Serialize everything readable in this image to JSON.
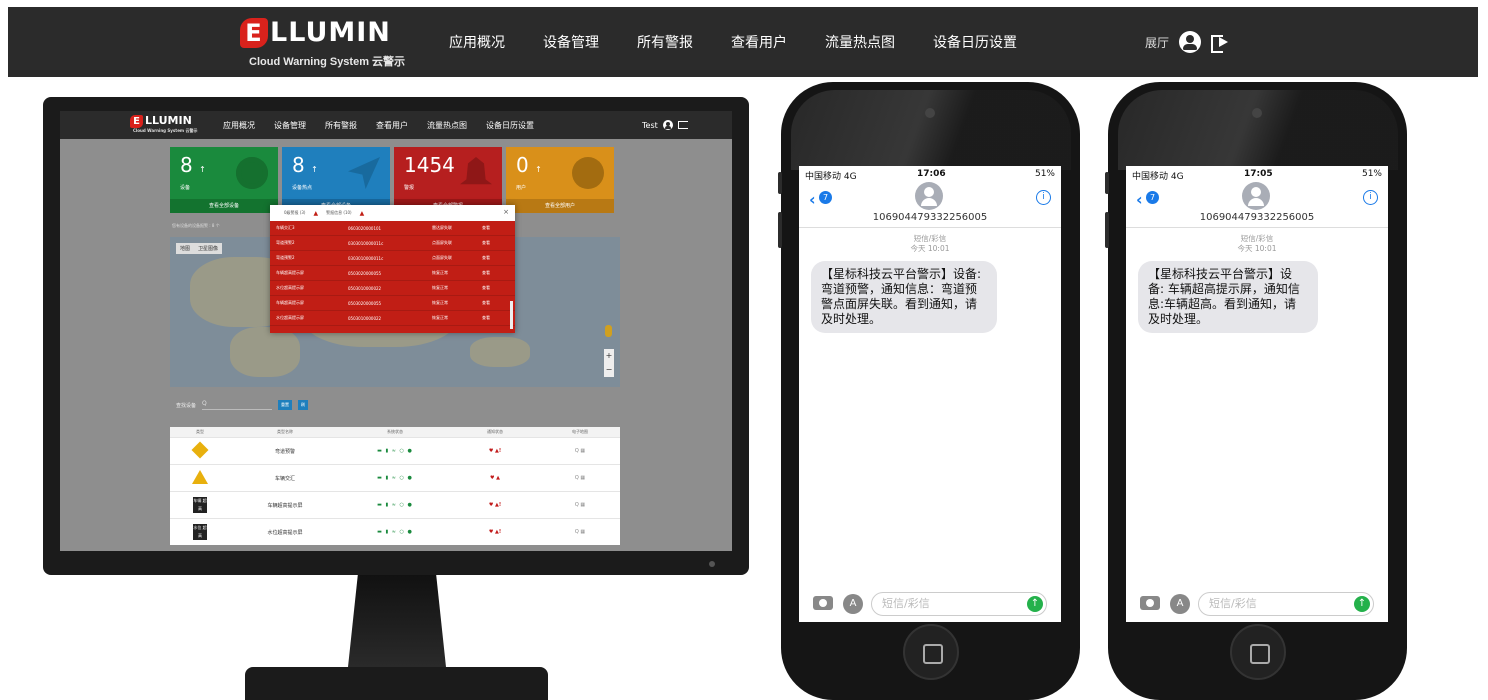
{
  "app": {
    "brand_name": "LLUMIN",
    "brand_initial": "E",
    "brand_subtitle": "Cloud  Warning System  云警示",
    "nav": [
      "应用概况",
      "设备管理",
      "所有警报",
      "查看用户",
      "流量热点图",
      "设备日历设置"
    ],
    "user_label": "展厅"
  },
  "monitor": {
    "nav": [
      "应用概况",
      "设备管理",
      "所有警报",
      "查看用户",
      "流量热点图",
      "设备日历设置"
    ],
    "user_label": "Test",
    "brand_subtitle": "Cloud Warning System 云警示",
    "cards": [
      {
        "value": "8",
        "arrow": "↑",
        "label": "设备",
        "footer": "查看全部设备"
      },
      {
        "value": "8",
        "arrow": "↑",
        "label": "设备热点",
        "footer": "查看全部设备"
      },
      {
        "value": "1454",
        "arrow": "",
        "label": "警报",
        "footer": "查看全部警报"
      },
      {
        "value": "0",
        "arrow": "↑",
        "label": "用户",
        "footer": "查看全部用户"
      }
    ],
    "filter_text": "您有设备的设备报警 : 8 个",
    "map_tabs": [
      "地图",
      "卫星图像"
    ],
    "modal": {
      "tabs": [
        "0级警报 (3)",
        "警报信息 (10)"
      ],
      "close": "×",
      "rows": [
        [
          "车辆交汇3",
          "0603020000101",
          "雷达屏失联",
          "查看"
        ],
        [
          "弯道预警2",
          "0303010000011c",
          "点面屏失联",
          "查看"
        ],
        [
          "弯道预警2",
          "0303010000011c",
          "点面屏失联",
          "查看"
        ],
        [
          "车辆超高提示屏",
          "0503020000055",
          "恢复正常",
          "查看"
        ],
        [
          "水位超高提示屏",
          "0503010000022",
          "恢复正常",
          "查看"
        ],
        [
          "车辆超高提示屏",
          "0503020000055",
          "恢复正常",
          "查看"
        ],
        [
          "水位超高提示屏",
          "0503010000022",
          "恢复正常",
          "查看"
        ]
      ]
    },
    "search": {
      "label": "查找设备",
      "placeholder": "Q",
      "btn1": "重置",
      "btn2": "刷"
    },
    "table": {
      "headers": [
        "类型",
        "类型名称",
        "系统状态",
        "通知状态",
        "电子地图"
      ],
      "rows": [
        {
          "icon": "diamond-warning-icon",
          "name": "弯道预警",
          "status": "▬ ▮ ≈ ○ ●",
          "notif": "♥ ▲!",
          "ops": "Q ▦"
        },
        {
          "icon": "triangle-warning-icon",
          "name": "车辆交汇",
          "status": "▬ ▮ ≈ ○ ●",
          "notif": "♥ ▲",
          "ops": "Q ▦"
        },
        {
          "icon": "vehicle-height-sign-icon",
          "icon_text": "车辆 超高",
          "name": "车辆超高提示屏",
          "status": "▬ ▮ ≈ ○ ●",
          "notif": "♥ ▲!",
          "ops": "Q ▦"
        },
        {
          "icon": "water-level-sign-icon",
          "icon_text": "水位 超高",
          "name": "水位超高提示屏",
          "status": "▬ ▮ ≈ ○ ●",
          "notif": "♥ ▲!",
          "ops": "Q ▦"
        }
      ]
    }
  },
  "phones": [
    {
      "carrier": "中国移动 4G",
      "time": "17:06",
      "battery": "51%",
      "badge": "7",
      "number": "106904479332256005",
      "meta_line1": "短信/彩信",
      "meta_line2": "今天 10:01",
      "message": "【星标科技云平台警示】设备: 弯道预警，通知信息：弯道预警点面屏失联。看到通知，请及时处理。",
      "input_placeholder": "短信/彩信"
    },
    {
      "carrier": "中国移动 4G",
      "time": "17:05",
      "battery": "51%",
      "badge": "7",
      "number": "106904479332256005",
      "meta_line1": "短信/彩信",
      "meta_line2": "今天 10:01",
      "message": "【星标科技云平台警示】设备: 车辆超高提示屏，通知信息:车辆超高。看到通知，请及时处理。",
      "input_placeholder": "短信/彩信"
    }
  ],
  "colors": {
    "navbar": "#2b2b2b",
    "brand_red": "#d9221c",
    "card_green": "#1a8a3d",
    "card_blue": "#1f7fbd",
    "card_red": "#b61f1f",
    "card_orange": "#d9901a",
    "ios_blue": "#1a7ae8",
    "send_green": "#24b14b"
  }
}
